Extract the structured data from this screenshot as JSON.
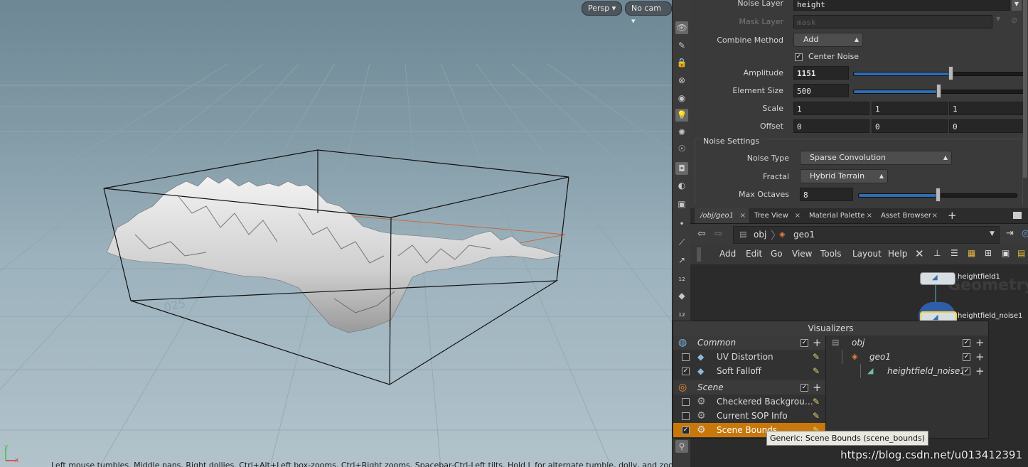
{
  "viewport": {
    "persp_label": "Persp",
    "cam_label": "No cam",
    "hint": "Left mouse tumbles. Middle pans. Right dollies. Ctrl+Alt+Left box-zooms. Ctrl+Right zooms. Spacebar-Ctrl-Left tilts. Hold L for alternate tumble, dolly, and zoom.",
    "ground_label": "025",
    "axis_y": "y",
    "axis_x": "x"
  },
  "params": {
    "noise_layer_label": "Noise Layer",
    "noise_layer_value": "height",
    "mask_layer_label": "Mask Layer",
    "mask_layer_placeholder": "mask",
    "combine_label": "Combine Method",
    "combine_value": "Add",
    "center_noise_label": "Center Noise",
    "amplitude_label": "Amplitude",
    "amplitude_value": "1151",
    "amplitude_slider": 0.57,
    "element_size_label": "Element Size",
    "element_size_value": "500",
    "element_size_slider": 0.5,
    "scale_label": "Scale",
    "scale_values": [
      "1",
      "1",
      "1"
    ],
    "offset_label": "Offset",
    "offset_values": [
      "0",
      "0",
      "0"
    ],
    "noise_settings_label": "Noise Settings",
    "noise_type_label": "Noise Type",
    "noise_type_value": "Sparse Convolution",
    "fractal_label": "Fractal",
    "fractal_value": "Hybrid Terrain",
    "max_octaves_label": "Max Octaves",
    "max_octaves_value": "8",
    "max_octaves_slider": 0.5
  },
  "tabs": [
    {
      "label": "/obj/geo1"
    },
    {
      "label": "Tree View"
    },
    {
      "label": "Material Palette"
    },
    {
      "label": "Asset Browser"
    }
  ],
  "path": {
    "obj": "obj",
    "geo": "geo1"
  },
  "netmenu": [
    "Add",
    "Edit",
    "Go",
    "View",
    "Tools",
    "Layout",
    "Help"
  ],
  "network": {
    "node1": "heightfield1",
    "node2": "heightfield_noise1",
    "context_watermark": "Geometry"
  },
  "visualizers": {
    "title": "Visualizers",
    "common_label": "Common",
    "uv_distortion": "UV Distortion",
    "soft_falloff": "Soft Falloff",
    "scene_label": "Scene",
    "checkered": "Checkered Backgrou…",
    "current_sop": "Current SOP Info",
    "scene_bounds": "Scene Bounds",
    "tree_obj": "obj",
    "tree_geo": "geo1",
    "tree_noise": "heightfield_noise1",
    "highlight_color": "#c8780a"
  },
  "tooltip": "Generic: Scene Bounds (scene_bounds)",
  "watermark": "https://blog.csdn.net/u013412391"
}
